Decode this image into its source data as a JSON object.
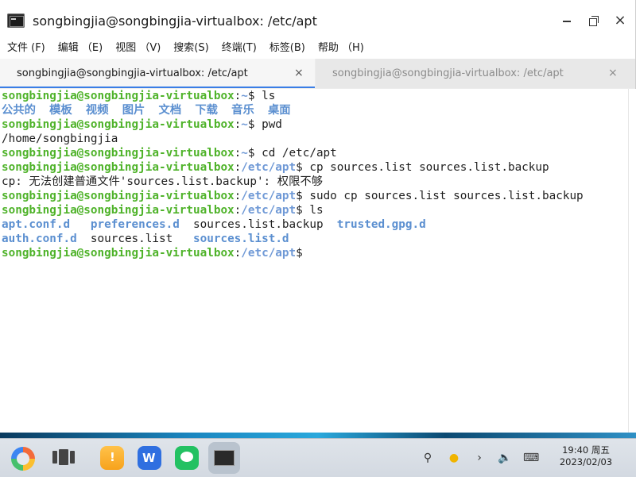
{
  "window": {
    "title": "songbingjia@songbingjia-virtualbox: /etc/apt",
    "controls": {
      "minimize": "",
      "maximize": "",
      "close": "×"
    }
  },
  "menu": {
    "items": [
      "文件 (F)",
      "编辑 （E)",
      "视图 （V)",
      "搜索(S)",
      "终端(T)",
      "标签(B)",
      "帮助 （H)"
    ]
  },
  "tabs": [
    {
      "label": "songbingjia@songbingjia-virtualbox: /etc/apt",
      "close": "×",
      "active": true
    },
    {
      "label": "songbingjia@songbingjia-virtualbox: /etc/apt",
      "close": "×",
      "active": false
    }
  ],
  "terminal": {
    "user_host": "songbingjia@songbingjia-virtualbox",
    "lines": [
      {
        "path": "~",
        "cmd": "ls"
      },
      {
        "output": "公共的  模板  视频  图片  文档  下载  音乐  桌面"
      },
      {
        "path": "~",
        "cmd": "pwd"
      },
      {
        "output": "/home/songbingjia"
      },
      {
        "path": "~",
        "cmd": "cd /etc/apt"
      },
      {
        "path": "/etc/apt",
        "cmd": "cp sources.list sources.list.backup"
      },
      {
        "output": "cp: 无法创建普通文件'sources.list.backup': 权限不够"
      },
      {
        "path": "/etc/apt",
        "cmd": "sudo cp sources.list sources.list.backup"
      },
      {
        "path": "/etc/apt",
        "cmd": "ls"
      },
      {
        "files": [
          "apt.conf.d",
          "preferences.d",
          "sources.list.backup",
          "trusted.gpg.d"
        ]
      },
      {
        "files": [
          "auth.conf.d",
          "sources.list",
          "sources.list.d"
        ]
      },
      {
        "path": "/etc/apt",
        "cmd": ""
      }
    ],
    "home_dirs": [
      "公共的",
      "模板",
      "视频",
      "图片",
      "文档",
      "下载",
      "音乐",
      "桌面"
    ],
    "colors": {
      "user": "#4fb32a",
      "dir": "#5b8fd0",
      "text": "#1e1e1e"
    }
  },
  "taskbar": {
    "clock_time": "19:40 周五",
    "clock_date": "2023/02/03",
    "icons": [
      "start-menu-icon",
      "multitask-view-icon",
      "file-manager-icon",
      "wps-office-icon",
      "wechat-icon",
      "terminal-icon"
    ],
    "tray": [
      "search-icon",
      "sun-icon",
      "chevron-right-icon",
      "volume-icon",
      "keyboard-icon"
    ]
  }
}
